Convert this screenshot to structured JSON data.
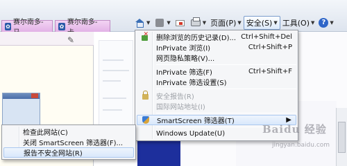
{
  "tabs": [
    {
      "label": "赛尔南多-马..."
    },
    {
      "label": "赛尔南多-卡..."
    }
  ],
  "command_bar": {
    "page_label": "页面(P)",
    "safety_label": "安全(S)",
    "tools_label": "工具(O)",
    "icons": [
      "home-icon",
      "rss-icon",
      "mail-icon",
      "print-icon",
      "help-icon"
    ]
  },
  "safety_menu": {
    "items": [
      {
        "label": "删除浏览的历史记录(D)...",
        "shortcut": "Ctrl+Shift+Del",
        "icon": "delete-history-icon"
      },
      {
        "label": "InPrivate 浏览(I)",
        "shortcut": "Ctrl+Shift+P"
      },
      {
        "label": "网页隐私策略(V)..."
      },
      {
        "label": "InPrivate 筛选(F)",
        "shortcut": "Ctrl+Shift+F"
      },
      {
        "label": "InPrivate 筛选设置(S)"
      },
      {
        "label": "安全报告(R)",
        "icon": "lock-icon"
      },
      {
        "label": "国际网站地址(I)"
      },
      {
        "label": "SmartScreen 筛选器(T)",
        "icon": "shield-icon"
      },
      {
        "label": "Windows Update(U)"
      }
    ]
  },
  "smartscreen_submenu": {
    "items": [
      {
        "label": "检查此网站(C)"
      },
      {
        "label": "关闭 SmartScreen 筛选器(F)..."
      },
      {
        "label": "报告不安全网站(R)"
      }
    ]
  },
  "watermark": {
    "logo": "Baidu 经验",
    "url": "jingyan.baidu.com"
  },
  "colors": {
    "tab_bg": "#e2b2e6",
    "menu_bg": "#f5f6f8",
    "highlight": "#d9e8fb",
    "disabled_text": "#9ea2a8"
  }
}
